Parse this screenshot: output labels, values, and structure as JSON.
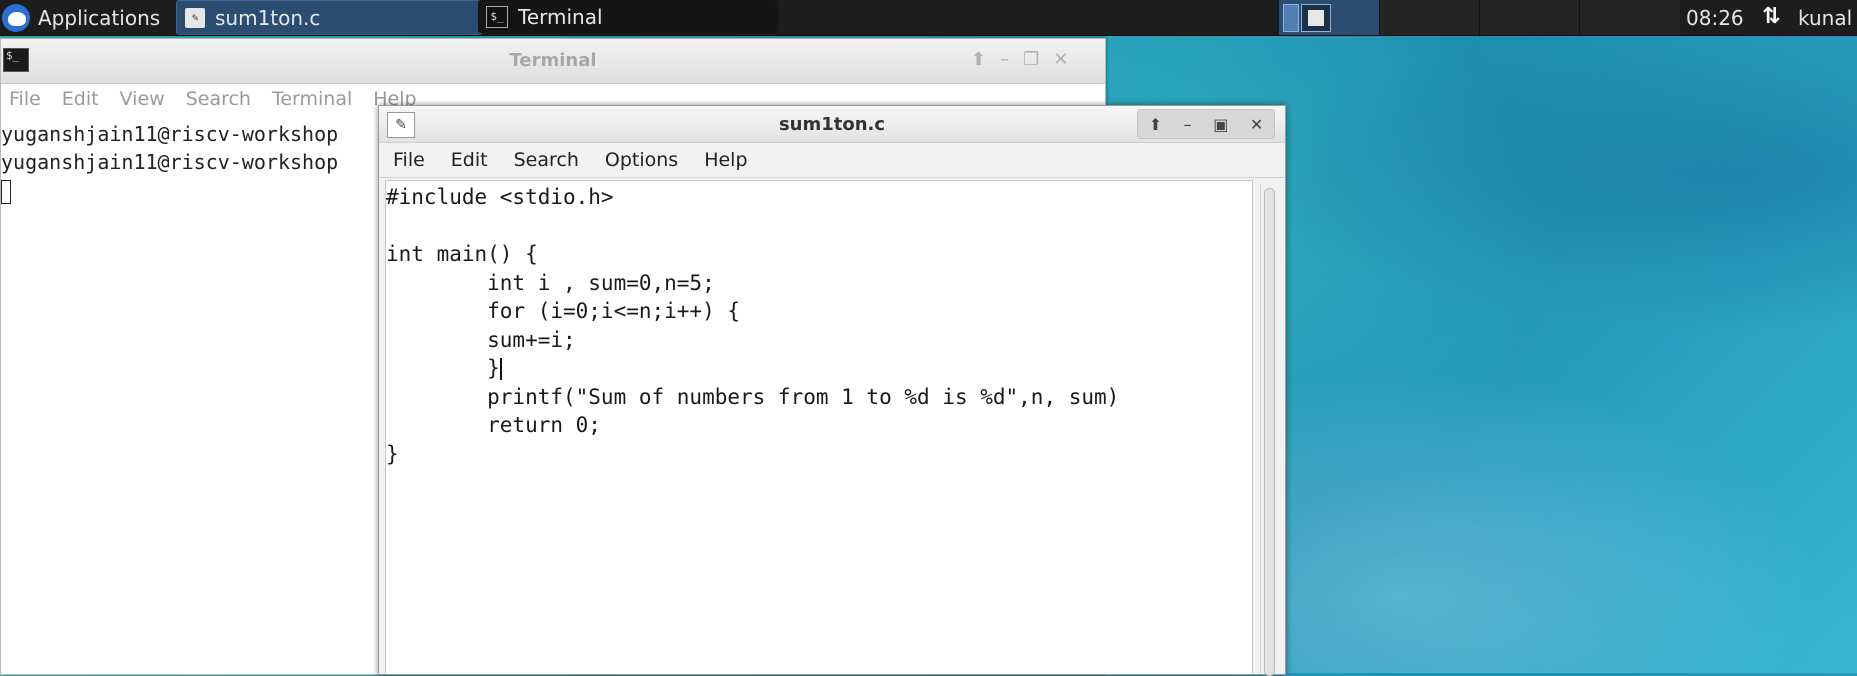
{
  "panel": {
    "applications_label": "Applications",
    "tasks": [
      {
        "label": "sum1ton.c",
        "icon": "text-editor-icon",
        "active": true
      },
      {
        "label": "Terminal",
        "icon": "terminal-icon",
        "active": false
      }
    ],
    "clock": "08:26",
    "user": "kunal"
  },
  "terminal": {
    "title": "Terminal",
    "menu": [
      "File",
      "Edit",
      "View",
      "Search",
      "Terminal",
      "Help"
    ],
    "lines": [
      "yuganshjain11@riscv-workshop",
      "yuganshjain11@riscv-workshop"
    ]
  },
  "editor": {
    "title": "sum1ton.c",
    "menu": [
      "File",
      "Edit",
      "Search",
      "Options",
      "Help"
    ],
    "lines": [
      "#include <stdio.h>",
      "",
      "int main() {",
      "        int i , sum=0,n=5;",
      "        for (i=0;i<=n;i++) {",
      "        sum+=i;",
      "        }",
      "        printf(\"Sum of numbers from 1 to %d is %d\",n, sum)",
      "        return 0;",
      "}"
    ]
  }
}
